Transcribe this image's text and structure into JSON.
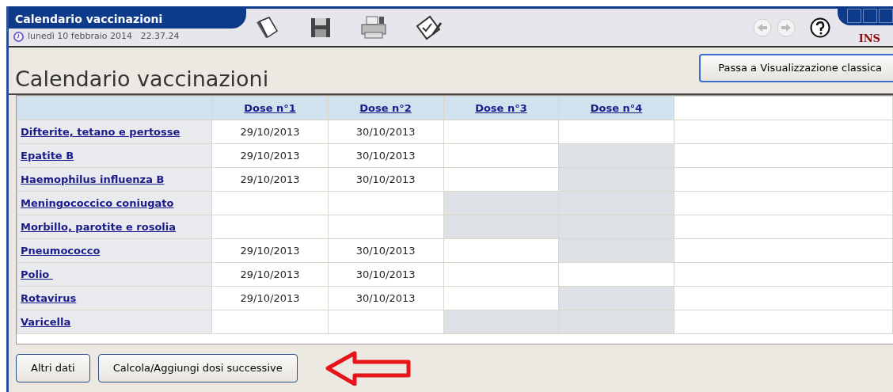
{
  "window": {
    "title": "Calendario vaccinazioni",
    "datetime": "lunedì 10 febbraio 2014   22.37.24",
    "mode": "INS"
  },
  "page_title": "Calendario vaccinazioni",
  "switch_button": "Passa a Visualizzazione classica",
  "table": {
    "columns": [
      "Dose n°1",
      "Dose n°2",
      "Dose n°3",
      "Dose n°4"
    ],
    "rows": [
      {
        "vaccine": "Difterite, tetano e pertosse",
        "doses": [
          {
            "text": "29/10/2013",
            "disabled": false
          },
          {
            "text": "30/10/2013",
            "disabled": false
          },
          {
            "disabled": false
          },
          {
            "disabled": false
          }
        ]
      },
      {
        "vaccine": "Epatite B",
        "doses": [
          {
            "text": "29/10/2013",
            "disabled": false
          },
          {
            "text": "30/10/2013",
            "disabled": false
          },
          {
            "disabled": false
          },
          {
            "disabled": true
          }
        ]
      },
      {
        "vaccine": "Haemophilus influenza B",
        "doses": [
          {
            "text": "29/10/2013",
            "disabled": false
          },
          {
            "text": "30/10/2013",
            "disabled": false
          },
          {
            "disabled": false
          },
          {
            "disabled": true
          }
        ]
      },
      {
        "vaccine": "Meningococcico coniugato",
        "doses": [
          {
            "disabled": false
          },
          {
            "disabled": false
          },
          {
            "disabled": true
          },
          {
            "disabled": true
          }
        ]
      },
      {
        "vaccine": "Morbillo, parotite e rosolia",
        "doses": [
          {
            "disabled": false
          },
          {
            "disabled": false
          },
          {
            "disabled": true
          },
          {
            "disabled": true
          }
        ]
      },
      {
        "vaccine": "Pneumococco",
        "doses": [
          {
            "text": "29/10/2013",
            "disabled": false
          },
          {
            "text": "30/10/2013",
            "disabled": false
          },
          {
            "disabled": false
          },
          {
            "disabled": true
          }
        ]
      },
      {
        "vaccine": "Polio ",
        "doses": [
          {
            "text": "29/10/2013",
            "disabled": false
          },
          {
            "text": "30/10/2013",
            "disabled": false
          },
          {
            "disabled": false
          },
          {
            "disabled": false
          }
        ]
      },
      {
        "vaccine": "Rotavirus",
        "doses": [
          {
            "text": "29/10/2013",
            "disabled": false
          },
          {
            "text": "30/10/2013",
            "disabled": false
          },
          {
            "disabled": false
          },
          {
            "disabled": true
          }
        ]
      },
      {
        "vaccine": "Varicella",
        "doses": [
          {
            "disabled": false
          },
          {
            "disabled": false
          },
          {
            "disabled": true
          },
          {
            "disabled": true
          }
        ]
      }
    ]
  },
  "buttons": [
    "Altri dati",
    "Calcola/Aggiungi dosi successive"
  ]
}
